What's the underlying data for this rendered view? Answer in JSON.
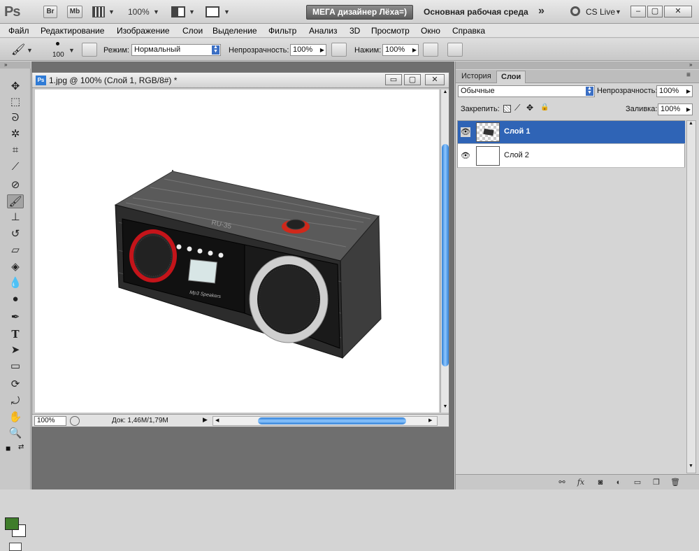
{
  "app": {
    "logo": "Ps",
    "bridge_label": "Br",
    "minibridge_label": "Mb",
    "zoom": "100%",
    "mega_label": "МЕГА дизайнер Лёха=)",
    "workspace": "Основная рабочая среда",
    "cs_live": "CS Live"
  },
  "menu": [
    "Файл",
    "Редактирование",
    "Изображение",
    "Слои",
    "Выделение",
    "Фильтр",
    "Анализ",
    "3D",
    "Просмотр",
    "Окно",
    "Справка"
  ],
  "options": {
    "brush_size": "100",
    "mode_label": "Режим:",
    "mode_value": "Нормальный",
    "opacity_label": "Непрозрачность:",
    "opacity_value": "100%",
    "pressure_label": "Нажим:",
    "pressure_value": "100%"
  },
  "document": {
    "title": "1.jpg @ 100% (Слой 1, RGB/8#) *",
    "zoom": "100%",
    "doc_info": "Док: 1,46M/1,79M",
    "radio_label": "RU-35",
    "radio_badge": "Mp3 Speakers"
  },
  "panel": {
    "tabs": [
      "История",
      "Слои"
    ],
    "active_tab": "Слои",
    "blend_mode": "Обычные",
    "opacity_label": "Непрозрачность:",
    "opacity_value": "100%",
    "lock_label": "Закрепить:",
    "fill_label": "Заливка:",
    "fill_value": "100%",
    "layers": [
      {
        "name": "Слой 1",
        "selected": true
      },
      {
        "name": "Слой 2",
        "selected": false
      }
    ]
  },
  "colors": {
    "foreground": "#3f7d2b",
    "background": "#ffffff",
    "selection": "#2f64b6"
  }
}
